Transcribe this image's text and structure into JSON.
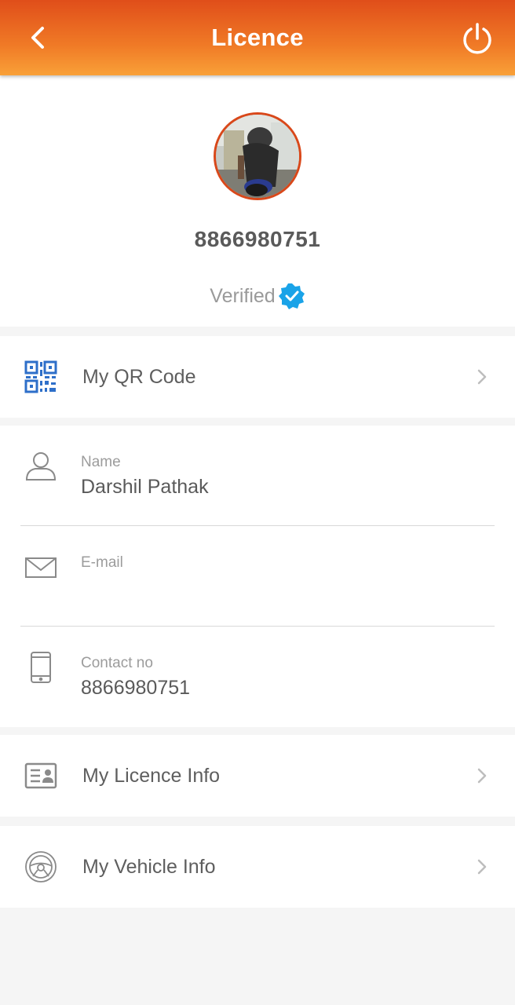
{
  "header": {
    "title": "Licence",
    "back_icon": "chevron-left-icon",
    "power_icon": "power-icon",
    "gradient_top": "#e04e1a",
    "gradient_bottom": "#f9a038"
  },
  "profile": {
    "phone": "8866980751",
    "verified_label": "Verified",
    "verified_icon": "verified-badge-icon",
    "badge_color": "#1aa3e8",
    "avatar_border": "#d9481a"
  },
  "qr_row": {
    "label": "My QR Code",
    "icon": "qr-code-icon"
  },
  "details": {
    "name": {
      "label": "Name",
      "value": "Darshil Pathak",
      "icon": "user-icon"
    },
    "email": {
      "label": "E-mail",
      "value": "",
      "icon": "mail-icon"
    },
    "contact": {
      "label": "Contact no",
      "value": "8866980751",
      "icon": "phone-icon"
    }
  },
  "licence_row": {
    "label": "My Licence Info",
    "icon": "id-card-icon"
  },
  "vehicle_row": {
    "label": "My Vehicle Info",
    "icon": "steering-wheel-icon"
  }
}
